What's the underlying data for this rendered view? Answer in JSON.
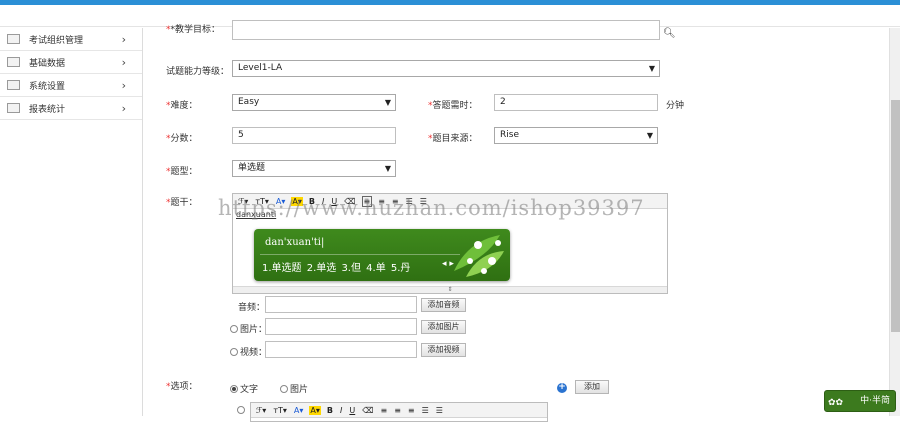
{
  "sidebar": {
    "items": [
      {
        "label": "考试组织管理",
        "icon": "folder-icon"
      },
      {
        "label": "基础数据",
        "icon": "folder-icon"
      },
      {
        "label": "系统设置",
        "icon": "folder-icon"
      },
      {
        "label": "报表统计",
        "icon": "folder-icon"
      }
    ]
  },
  "form": {
    "teaching_goal_label": "*教学目标：",
    "ability_label": "试题能力等级：",
    "ability_value": "Level1-LA",
    "difficulty_label": "难度：",
    "difficulty_value": "Easy",
    "time_label": "答题需时：",
    "time_value": "2",
    "time_unit": "分钟",
    "score_label": "分数：",
    "score_value": "5",
    "source_label": "题目来源：",
    "source_value": "Rise",
    "type_label": "题型：",
    "type_value": "单选题",
    "stem_label": "题干：",
    "stem_text": "danxuanti",
    "audio_label": "音频：",
    "audio_btn": "添加音频",
    "image_label": "图片：",
    "image_btn": "添加图片",
    "video_label": "视频：",
    "video_btn": "添加视频",
    "options_label": "选项：",
    "opt_text": "文字",
    "opt_image": "图片",
    "add_btn": "添加"
  },
  "ime": {
    "pinyin": "dan'xuan'ti|",
    "candidates": "1.单选题  2.单选  3.但  4.单  5.丹"
  },
  "watermark": "https://www.huzhan.com/ishop39397",
  "ime_badge": "中·半简",
  "colors": {
    "accent": "#2b8fd6",
    "ime_green": "#3f8a1d",
    "required": "#e33333"
  }
}
